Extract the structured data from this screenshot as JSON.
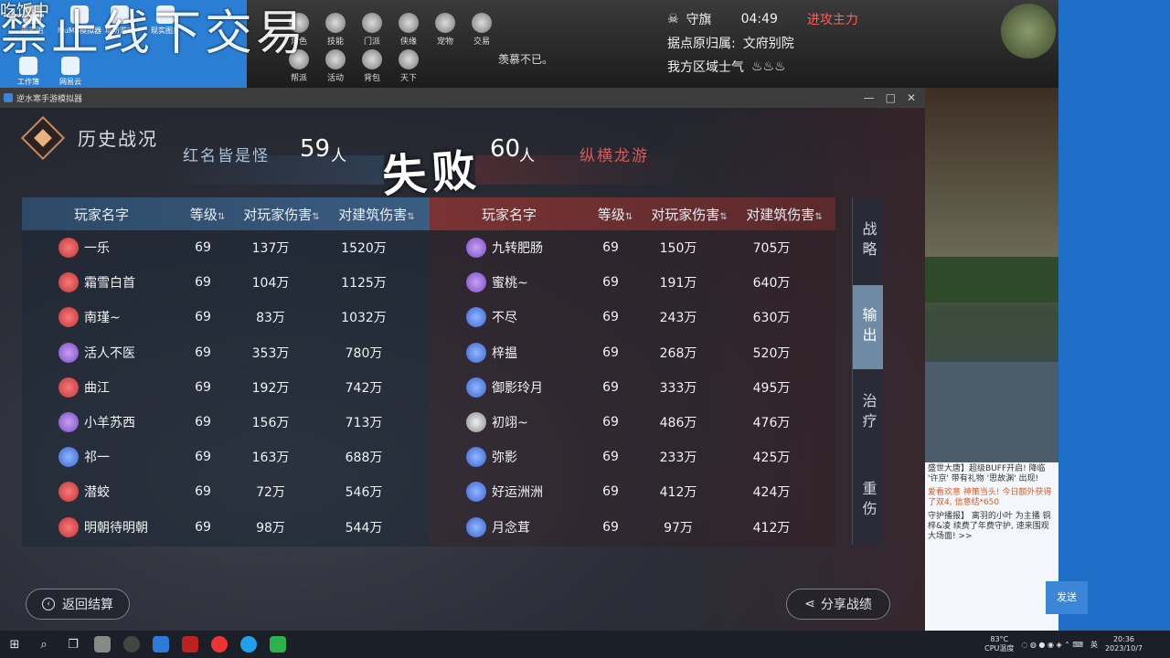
{
  "overlay": {
    "top_left_text": "吃饭中",
    "watermark": "禁止线下交易"
  },
  "desktop": {
    "icons": [
      "嵌天明",
      "MuMu模拟器",
      "塔防游戏",
      "现实图片",
      "工作簿",
      "网易云"
    ]
  },
  "game_hud": {
    "buttons": [
      "角色",
      "技能",
      "门派",
      "侠缘",
      "宠物",
      "交易",
      "帮派",
      "活动",
      "背包",
      "天下"
    ],
    "flag_label": "守旗",
    "timer": "04:49",
    "attack_label": "进攻主力",
    "stronghold_text": "据点原归属:",
    "stronghold_owner": "文府别院",
    "morale_label": "我方区域士气",
    "bubble_text": "羡慕不已。"
  },
  "emulator": {
    "title": "逆水寒手游模拟器",
    "controls": [
      "—",
      "□",
      "✕"
    ]
  },
  "panel": {
    "title": "历史战况",
    "left_team": {
      "name": "红名皆是怪",
      "count": "59",
      "unit": "人"
    },
    "result": "失败",
    "right_team": {
      "name": "纵横龙游",
      "count": "60",
      "unit": "人"
    },
    "headers": {
      "name": "玩家名字",
      "level": "等级",
      "player_damage": "对玩家伤害",
      "building_damage": "对建筑伤害",
      "sort_icon": "⇅"
    },
    "left_rows": [
      {
        "icon": "red",
        "name": "一乐",
        "level": "69",
        "pd": "137万",
        "bd": "1520万"
      },
      {
        "icon": "red",
        "name": "霜雪白首",
        "level": "69",
        "pd": "104万",
        "bd": "1125万"
      },
      {
        "icon": "red",
        "name": "南瑾~",
        "level": "69",
        "pd": "83万",
        "bd": "1032万"
      },
      {
        "icon": "purple",
        "name": "活人不医",
        "level": "69",
        "pd": "353万",
        "bd": "780万"
      },
      {
        "icon": "red",
        "name": "曲江",
        "level": "69",
        "pd": "192万",
        "bd": "742万"
      },
      {
        "icon": "purple",
        "name": "小羊苏西",
        "level": "69",
        "pd": "156万",
        "bd": "713万"
      },
      {
        "icon": "blue",
        "name": "祁一",
        "level": "69",
        "pd": "163万",
        "bd": "688万"
      },
      {
        "icon": "red",
        "name": "潜蛟",
        "level": "69",
        "pd": "72万",
        "bd": "546万"
      },
      {
        "icon": "red",
        "name": "明朝待明朝",
        "level": "69",
        "pd": "98万",
        "bd": "544万"
      }
    ],
    "right_rows": [
      {
        "icon": "purple",
        "name": "九转肥肠",
        "level": "69",
        "pd": "150万",
        "bd": "705万"
      },
      {
        "icon": "purple",
        "name": "蜜桃~",
        "level": "69",
        "pd": "191万",
        "bd": "640万"
      },
      {
        "icon": "blue",
        "name": "不尽",
        "level": "69",
        "pd": "243万",
        "bd": "630万"
      },
      {
        "icon": "blue",
        "name": "梓揾",
        "level": "69",
        "pd": "268万",
        "bd": "520万"
      },
      {
        "icon": "blue",
        "name": "御影玲月",
        "level": "69",
        "pd": "333万",
        "bd": "495万"
      },
      {
        "icon": "silver",
        "name": "初翊~",
        "level": "69",
        "pd": "486万",
        "bd": "476万"
      },
      {
        "icon": "blue",
        "name": "弥影",
        "level": "69",
        "pd": "233万",
        "bd": "425万"
      },
      {
        "icon": "blue",
        "name": "好运洲洲",
        "level": "69",
        "pd": "412万",
        "bd": "424万"
      },
      {
        "icon": "blue",
        "name": "月念茸",
        "level": "69",
        "pd": "97万",
        "bd": "412万"
      }
    ],
    "side_tabs": [
      "战略",
      "输出",
      "治疗",
      "重伤"
    ],
    "active_tab": 1,
    "back_label": "返回结算",
    "share_label": "分享战绩"
  },
  "chat": {
    "lines": [
      {
        "text": "盛世大唐】超级BUFF开启! 降临 '许京' 带有礼物 '思故渊' 出现!",
        "hl": false
      },
      {
        "text": "爱看欢意 神策当头! 今日额外获得了双4, 信意结*650",
        "hl": true
      },
      {
        "text": "守护播报】 离羽的小叶 为主播 铜梓&凌 续费了年费守护, 速来围观大场面! >>",
        "hl": false
      }
    ],
    "send_label": "发送"
  },
  "taskbar": {
    "temp": "83°C",
    "cpu_label": "CPU温度",
    "ime": "英",
    "time": "20:36",
    "date": "2023/10/7"
  }
}
